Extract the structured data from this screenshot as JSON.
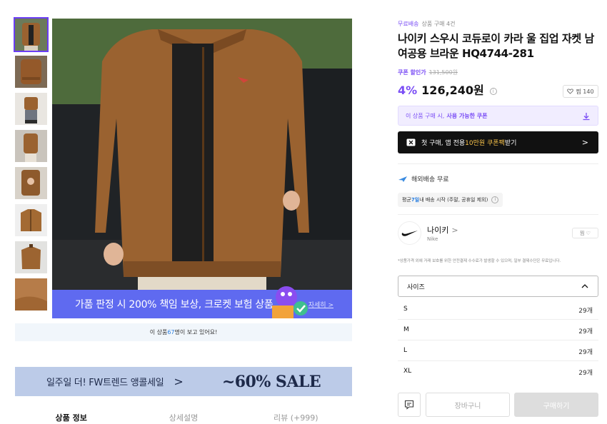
{
  "gallery": {
    "thumbnails": [
      {
        "name": "thumb-front-view",
        "selected": true
      },
      {
        "name": "thumb-back-view",
        "selected": false
      },
      {
        "name": "thumb-seated-view",
        "selected": false
      },
      {
        "name": "thumb-side-view",
        "selected": false
      },
      {
        "name": "thumb-hands-view",
        "selected": false
      },
      {
        "name": "thumb-flat-lay",
        "selected": false
      },
      {
        "name": "thumb-hanger-view",
        "selected": false
      },
      {
        "name": "thumb-detail-view",
        "selected": false
      }
    ],
    "banner_text": "가품 판정 시 200% 책임 보상, 크로켓 보험 상품",
    "banner_link": "자세히 >",
    "viewers_prefix": "이 상품 ",
    "viewers_count": "67",
    "viewers_suffix": "명이 보고 있어요!"
  },
  "promo": {
    "text": "일주일 더! FW트렌드 앵콜세일",
    "arrow": ">",
    "sale": "~60% SALE"
  },
  "tabs": [
    {
      "label": "상품 정보",
      "active": true
    },
    {
      "label": "상세설명",
      "active": false
    },
    {
      "label": "리뷰 (+999)",
      "active": false
    }
  ],
  "product": {
    "free_shipping": "무료배송",
    "purchase_count": "상품 구매 4건",
    "title": "나이키 스우시 코듀로이 카라 울 집업 자켓 남여공용 브라운 HQ4744-281",
    "coupon_price_label": "쿠폰 할인가",
    "original_price": "131,500원",
    "discount_rate": "4%",
    "price": "126,240원",
    "info_icon": "i",
    "like_count": "찜 140",
    "coupon_box_prefix": "이 상품 구매 시,",
    "coupon_box_bold": "사용 가능한 쿠폰",
    "promo_bar_prefix": "첫 구매, 앱 전용 ",
    "promo_bar_highlight": "10만원 쿠폰팩",
    "promo_bar_suffix": " 받기",
    "promo_bar_chevron": ">",
    "shipping_label": "해외배송 무료",
    "avg_delivery_prefix": "평균 ",
    "avg_delivery_days": "7일",
    "avg_delivery_suffix": " 내 배송 시작 (주말, 공휴일 제외)",
    "avg_delivery_icon": "i"
  },
  "brand": {
    "name": "나이키",
    "chevron": ">",
    "sub": "Nike",
    "follow": "찜 ♡"
  },
  "notice": "*상품가격 외에 거래 보호를 위한 안전결제 수수료가 발생할 수 있으며, 일부 결제수단은 무료입니다.",
  "size_select": {
    "label": "사이즈",
    "options": [
      {
        "size": "S",
        "qty": "29개"
      },
      {
        "size": "M",
        "qty": "29개"
      },
      {
        "size": "L",
        "qty": "29개"
      },
      {
        "size": "XL",
        "qty": "29개"
      }
    ]
  },
  "actions": {
    "cart": "장바구니",
    "buy": "구매하기"
  },
  "colors": {
    "accent": "#7a4df5",
    "banner": "#5f6af0",
    "promo_bg": "#bccbe8",
    "jacket": "#9a6230"
  }
}
